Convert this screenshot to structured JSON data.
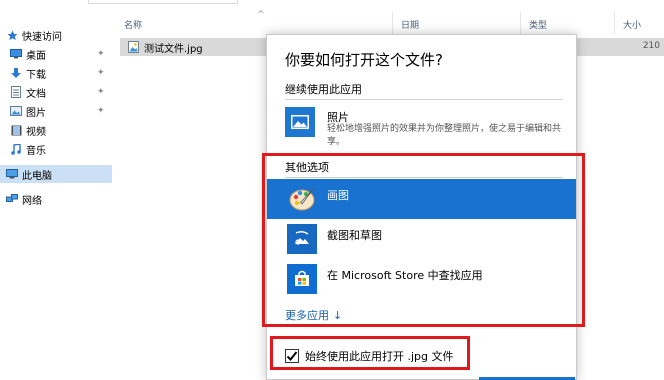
{
  "sidebar": {
    "items": [
      {
        "label": "快速访问",
        "icon": "star-icon",
        "pinned": false
      },
      {
        "label": "桌面",
        "icon": "desktop-icon",
        "pinned": true
      },
      {
        "label": "下载",
        "icon": "download-icon",
        "pinned": true
      },
      {
        "label": "文档",
        "icon": "document-icon",
        "pinned": true
      },
      {
        "label": "图片",
        "icon": "picture-icon",
        "pinned": true
      },
      {
        "label": "视频",
        "icon": "video-icon",
        "pinned": false
      },
      {
        "label": "音乐",
        "icon": "music-icon",
        "pinned": false
      },
      {
        "label": "此电脑",
        "icon": "computer-icon",
        "pinned": false
      },
      {
        "label": "网络",
        "icon": "network-icon",
        "pinned": false
      }
    ],
    "pin_glyph": "📌"
  },
  "file_list": {
    "columns": {
      "name": "名称",
      "date": "日期",
      "type": "类型",
      "size": "大小"
    },
    "sort_caret": "^",
    "rows": [
      {
        "name": "测试文件.jpg",
        "size": "210"
      }
    ]
  },
  "dialog": {
    "title": "你要如何打开这个文件?",
    "keep_using_heading": "继续使用此应用",
    "current_app": {
      "name": "照片",
      "description": "轻松地增强照片的效果并为你整理照片，使之易于编辑和共享。"
    },
    "other_options_heading": "其他选项",
    "options": [
      {
        "label": "画图",
        "icon": "paint-icon",
        "selected": true
      },
      {
        "label": "截图和草图",
        "icon": "snip-sketch-icon",
        "selected": false
      },
      {
        "label": "在 Microsoft Store 中查找应用",
        "icon": "store-icon",
        "selected": false
      }
    ],
    "more_apps": "更多应用",
    "more_apps_arrow": "↓",
    "always_use_label": "始终使用此应用打开 .jpg 文件",
    "always_use_checked": true
  },
  "colors": {
    "accent": "#1a72d0",
    "annotation": "#e0191c",
    "selected_row": "#d9d9d9",
    "nav_selected": "#cce0f5"
  }
}
